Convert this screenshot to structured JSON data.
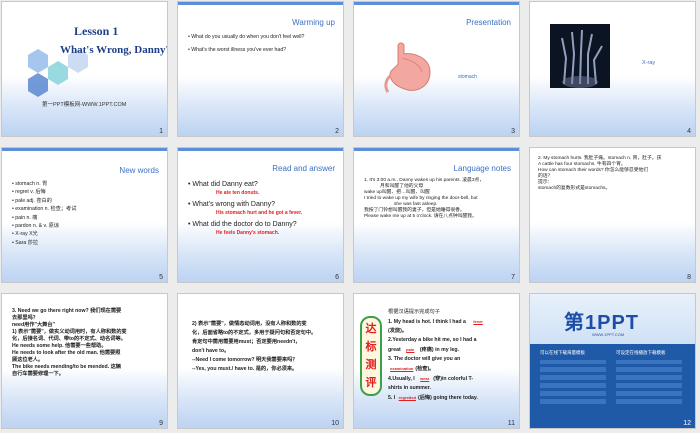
{
  "slides": [
    {
      "num": "1",
      "title": "Lesson 1",
      "subtitle": "What's Wrong, Danny?",
      "site": "第一PPT模板网-WWW.1PPT.COM"
    },
    {
      "num": "2",
      "heading": "Warming up",
      "items": [
        "What do you usually do when you don't feel well?",
        "What's the worst illness you've ever had?"
      ]
    },
    {
      "num": "3",
      "heading": "Presentation",
      "label": "stomach"
    },
    {
      "num": "4",
      "label": "X-ray"
    },
    {
      "num": "5",
      "heading": "New words",
      "items": [
        "stomach n. 胃",
        "regret v. 后悔",
        "pale adj. 苍白的",
        "examination n. 检查；考试",
        "pain n. 痛",
        "pardon n. & v. 原谅",
        "X-ray X光",
        "Sara 莎拉"
      ]
    },
    {
      "num": "6",
      "heading": "Read and answer",
      "q1": "What did Danny eat?",
      "a1": "He ate ten donuts.",
      "q2": "What's wrong with Danny?",
      "a2": "His stomach hurt and he got a fever.",
      "q3": "What did the doctor do to Danny?",
      "a3": "He feels Danny's stomach."
    },
    {
      "num": "7",
      "heading": "Language notes",
      "lines": [
        "1. It's 3:00 a.m., Danny wakes up his parents. 凌晨3点，",
        "月和叫醒了他的父母",
        "wake up叫醒、把…叫醒、叫醒",
        "I tried to wake up my wife by ringing the door-bell, but",
        "she was fast asleep.",
        "我按了门铃想叫醒我的妻子，但是她睡得很香。",
        "Please wake me up at 5 o'clock. 请在八点钟叫醒我。"
      ]
    },
    {
      "num": "8",
      "lines": [
        "2. My stomach hurts. 我肚子痛。stomach n. 胃，肚子。孩",
        "A cattle has four stomachs. 牛有四个胃。",
        "How can stomach their words? 你怎么能够忍受他们",
        "的话？",
        "提示：",
        "stomach的复数形式是stomachs。"
      ]
    },
    {
      "num": "9",
      "lines": [
        "3. Need we go there right now? 我们现在需要",
        "去那里吗？",
        "need用作\"大舞台\"",
        "1) 表示\"需要\"，做实义动词用时，有人称和数的变",
        "化，后接名词、代词、带to的不定式、动名词等。",
        "He needs some help. 他需要一些帮助。",
        "He needs to look after the old man. 他需要照",
        "顾这位老人。",
        "The bike needs mending/to be mended. 这辆",
        "自行车需要修理一下。"
      ]
    },
    {
      "num": "10",
      "lines": [
        "2) 表示\"需要\"，做情态动词用，没有人称和数的变",
        "化，后面省略to的不定式，多用于疑问句和否定句中。",
        "肯定句中需用需要用must；否定要用needn't，",
        "don't have to。",
        "--Need I come tomorrow? 明天我需要来吗？",
        "--Yes, you must./ have to. 是的，你必须来。"
      ]
    },
    {
      "num": "11",
      "stamp": [
        "达",
        "标",
        "测",
        "评"
      ],
      "intro": "根据汉语提示完成句子",
      "lines": [
        "1. My head is hot. I think I had a",
        "(发烧)。",
        "2.Yesterday a bike hit me, so I had a",
        "great",
        "(疼痛) in my leg.",
        "3. The doctor will give you an",
        "(检查)。",
        "4.Usually, I",
        "(穿)in colorful T-",
        "shirts in summer.",
        "5. I",
        "(后悔) going there today."
      ],
      "answers": [
        "fever",
        "pain",
        "examination",
        "wear",
        "regretted"
      ]
    },
    {
      "num": "12",
      "logo": "第1PPT",
      "logo_sub": "WWW.1PPT.COM",
      "col1": "可以在线下载海量模板",
      "col2": "可设定在线播放下载模板"
    }
  ]
}
